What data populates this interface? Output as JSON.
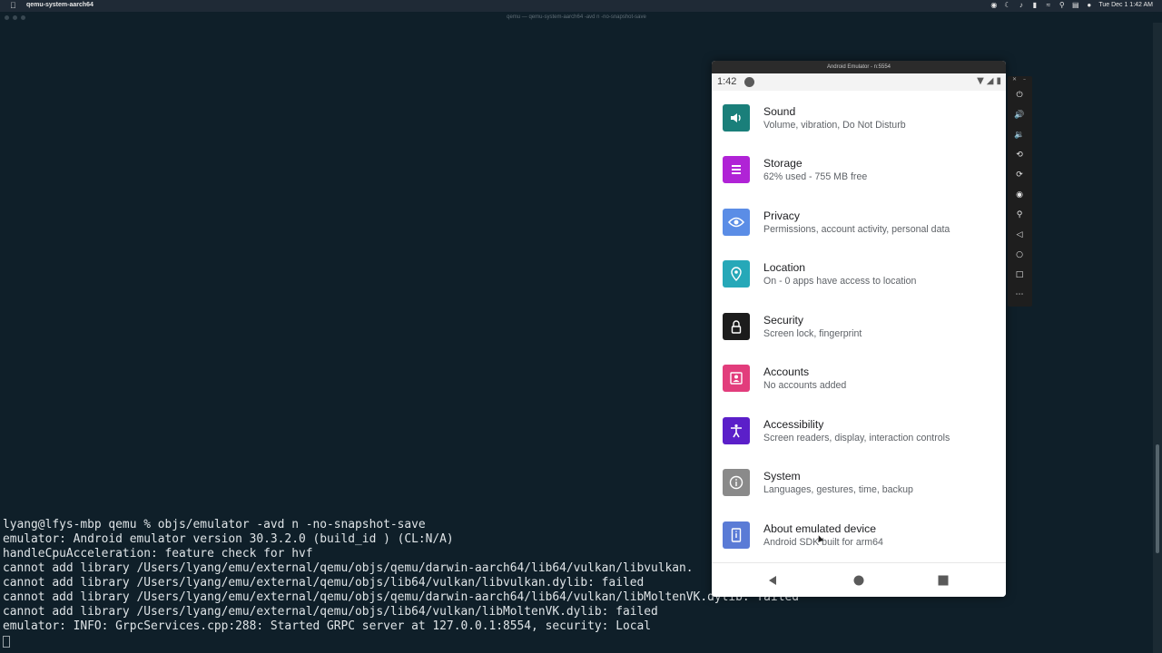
{
  "menubar": {
    "app_name": "qemu-system-aarch64",
    "clock": "Tue Dec 1  1:42 AM"
  },
  "terminal": {
    "title": "qemu — qemu-system-aarch64 -avd n -no-snapshot-save",
    "lines": [
      "lyang@lfys-mbp qemu % objs/emulator -avd n -no-snapshot-save",
      "emulator: Android emulator version 30.3.2.0 (build_id ) (CL:N/A)",
      "handleCpuAcceleration: feature check for hvf",
      "cannot add library /Users/lyang/emu/external/qemu/objs/qemu/darwin-aarch64/lib64/vulkan/libvulkan.",
      "cannot add library /Users/lyang/emu/external/qemu/objs/lib64/vulkan/libvulkan.dylib: failed",
      "cannot add library /Users/lyang/emu/external/qemu/objs/qemu/darwin-aarch64/lib64/vulkan/libMoltenVK.dylib: failed",
      "cannot add library /Users/lyang/emu/external/qemu/objs/lib64/vulkan/libMoltenVK.dylib: failed",
      "emulator: INFO: GrpcServices.cpp:288: Started GRPC server at 127.0.0.1:8554, security: Local"
    ]
  },
  "emulator": {
    "window_title": "Android Emulator - n:5554",
    "status_time": "1:42"
  },
  "settings": {
    "items": [
      {
        "title": "Sound",
        "subtitle": "Volume, vibration, Do Not Disturb",
        "icon": "volume-icon",
        "color": "#1a7f7a"
      },
      {
        "title": "Storage",
        "subtitle": "62% used - 755 MB free",
        "icon": "storage-icon",
        "color": "#b023d6"
      },
      {
        "title": "Privacy",
        "subtitle": "Permissions, account activity, personal data",
        "icon": "eye-icon",
        "color": "#5b8de6"
      },
      {
        "title": "Location",
        "subtitle": "On - 0 apps have access to location",
        "icon": "location-pin-icon",
        "color": "#26a8b8"
      },
      {
        "title": "Security",
        "subtitle": "Screen lock, fingerprint",
        "icon": "lock-icon",
        "color": "#1c1c1c"
      },
      {
        "title": "Accounts",
        "subtitle": "No accounts added",
        "icon": "account-icon",
        "color": "#e23d7c"
      },
      {
        "title": "Accessibility",
        "subtitle": "Screen readers, display, interaction controls",
        "icon": "accessibility-icon",
        "color": "#5b1fc9"
      },
      {
        "title": "System",
        "subtitle": "Languages, gestures, time, backup",
        "icon": "info-icon",
        "color": "#8a8a8a"
      },
      {
        "title": "About emulated device",
        "subtitle": "Android SDK built for arm64",
        "icon": "device-icon",
        "color": "#5a7bd6"
      }
    ]
  }
}
